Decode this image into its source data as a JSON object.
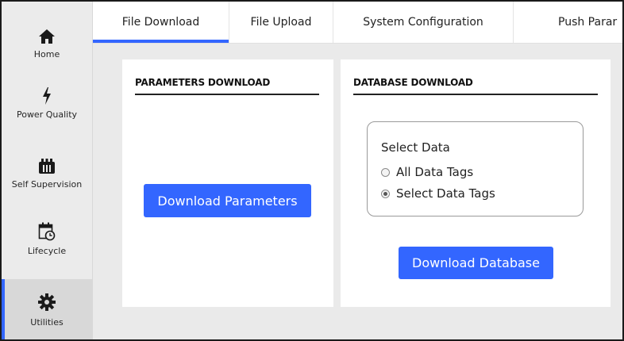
{
  "sidebar": {
    "items": [
      {
        "label": "Home",
        "icon": "home-icon"
      },
      {
        "label": "Power Quality",
        "icon": "lightning-icon"
      },
      {
        "label": "Self Supervision",
        "icon": "self-supervision-icon"
      },
      {
        "label": "Lifecycle",
        "icon": "calendar-clock-icon"
      },
      {
        "label": "Utilities",
        "icon": "gear-icon",
        "active": true
      }
    ]
  },
  "tabs": [
    {
      "label": "File Download",
      "active": true
    },
    {
      "label": "File Upload"
    },
    {
      "label": "System Configuration"
    },
    {
      "label": "Push Parar"
    }
  ],
  "parameters_card": {
    "title": "PARAMETERS DOWNLOAD",
    "button_label": "Download Parameters"
  },
  "database_card": {
    "title": "DATABASE DOWNLOAD",
    "select_title": "Select Data",
    "options": [
      {
        "label": "All Data Tags",
        "checked": false
      },
      {
        "label": "Select Data Tags",
        "checked": true
      }
    ],
    "button_label": "Download Database"
  },
  "colors": {
    "accent": "#3366ff",
    "sidebar_bg": "#ebebeb",
    "content_bg": "#eaeaea"
  }
}
